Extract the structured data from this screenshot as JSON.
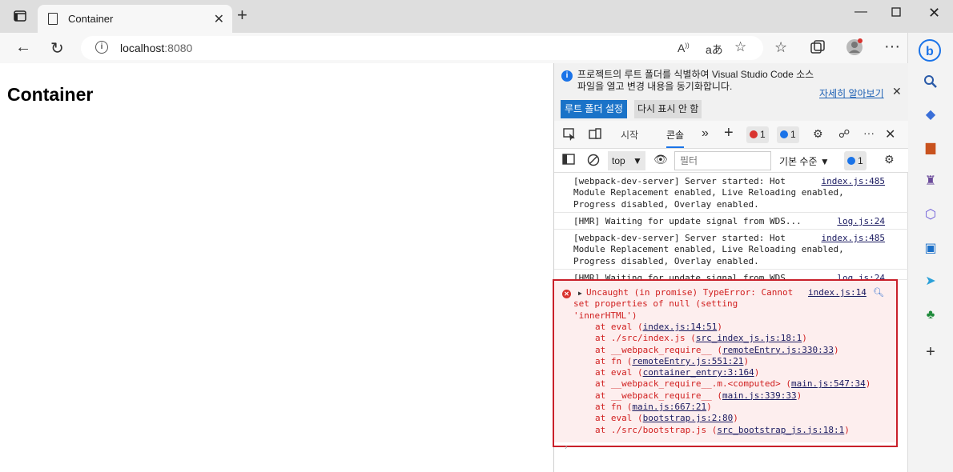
{
  "browser": {
    "tab_title": "Container",
    "url_host": "localhost",
    "url_port": ":8080"
  },
  "page": {
    "heading": "Container"
  },
  "devtools": {
    "infobar": {
      "message": "프로젝트의 루트 폴더를 식별하여 Visual Studio Code 소스 파일을 열고 변경 내용을 동기화합니다.",
      "learn_more": "자세히 알아보기",
      "set_root_button": "루트 폴더 설정",
      "dont_show_button": "다시 표시 안 함"
    },
    "tabs": {
      "welcome": "시작",
      "console": "콘솔",
      "error_count": "1",
      "issue_count": "1"
    },
    "console_bar": {
      "context": "top",
      "filter_placeholder": "필터",
      "level": "기본 수준",
      "issue_count": "1"
    },
    "log": [
      {
        "text": "[webpack-dev-server] Server started: Hot\nModule Replacement enabled, Live Reloading enabled,\nProgress disabled, Overlay enabled.",
        "source": "index.js:485"
      },
      {
        "text": "[HMR] Waiting for update signal from WDS...",
        "source": "log.js:24"
      },
      {
        "text": "[webpack-dev-server] Server started: Hot\nModule Replacement enabled, Live Reloading enabled,\nProgress disabled, Overlay enabled.",
        "source": "index.js:485"
      },
      {
        "text": "[HMR] Waiting for update signal from WDS...",
        "source": "log.js:24"
      }
    ],
    "error": {
      "message": "Uncaught (in promise) TypeError: Cannot\nset properties of null (setting\n'innerHTML')",
      "source": "index.js:14",
      "stack": [
        {
          "prefix": "at eval (",
          "link": "index.js:14:51",
          "suffix": ")"
        },
        {
          "prefix": "at ./src/index.js (",
          "link": "src_index_js.js:18:1",
          "suffix": ")"
        },
        {
          "prefix": "at __webpack_require__ (",
          "link": "remoteEntry.js:330:33",
          "suffix": ")"
        },
        {
          "prefix": "at fn (",
          "link": "remoteEntry.js:551:21",
          "suffix": ")"
        },
        {
          "prefix": "at eval (",
          "link": "container_entry:3:164",
          "suffix": ")"
        },
        {
          "prefix": "at __webpack_require__.m.<computed> (",
          "link": "main.js:547:34",
          "suffix": ")"
        },
        {
          "prefix": "at __webpack_require__ (",
          "link": "main.js:339:33",
          "suffix": ")"
        },
        {
          "prefix": "at fn (",
          "link": "main.js:667:21",
          "suffix": ")"
        },
        {
          "prefix": "at eval (",
          "link": "bootstrap.js:2:80",
          "suffix": ")"
        },
        {
          "prefix": "at ./src/bootstrap.js (",
          "link": "src_bootstrap_js.js:18:1",
          "suffix": ")"
        }
      ]
    }
  },
  "colors": {
    "error_text": "#d01e1e",
    "error_bg": "#fdeeee",
    "highlight_border": "#c9202a",
    "accent": "#1a73c8"
  }
}
